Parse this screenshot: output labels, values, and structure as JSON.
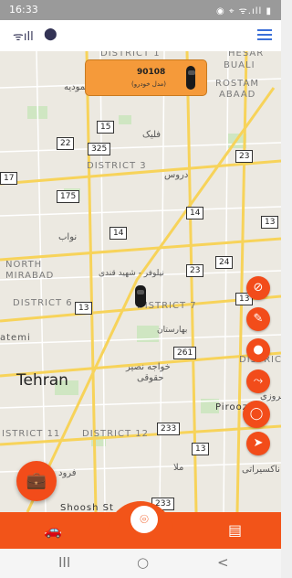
{
  "status_bar": {
    "time": "16:33",
    "right": "◉ ⌖ ᯤ.ıll ▮"
  },
  "header": {
    "signal_icon": "signal-icon",
    "location_icon": "location-pin-icon"
  },
  "map": {
    "districts": [
      "DISTRICT 1",
      "DISTRICT 3",
      "DISTRICT 6",
      "DISTRICT 7",
      "DISTRICT 12",
      "ISTRICT 11",
      "NORTH",
      "MIRABAD",
      "HESAR",
      "BUALI",
      "ROSTAM",
      "ABAAD",
      "DISTRICT"
    ],
    "city": "Tehran",
    "roads": [
      "15",
      "22",
      "325",
      "175",
      "14",
      "14",
      "23",
      "24",
      "23",
      "13",
      "261",
      "233",
      "13",
      "233",
      "17",
      "13",
      "13"
    ],
    "persian": [
      "جمودیه",
      "فلیک",
      "دروس",
      "نواب",
      "نیلوفر - شهید قندی",
      "خواجه نصیر",
      "حقوقی",
      "بهارستان",
      "پیروزی",
      "Piroozi",
      "Shoosh St",
      "فرود",
      "ملا",
      "ناکسیراتی",
      "atemi"
    ]
  },
  "vehicle_card": {
    "plate": "90108",
    "subtitle": "(مدل خودرو)"
  },
  "fab_icons": [
    "no-location-icon",
    "eraser-icon",
    "pin-icon",
    "route-icon",
    "circle-icon",
    "navigate-icon"
  ],
  "briefcase_button_icon": "briefcase-icon",
  "bottom_nav": {
    "left_icon": "car-icon",
    "center_icon": "pin-icon",
    "right_icon": "chat-icon"
  },
  "system_nav": {
    "recent": "III",
    "home": "○",
    "back": "<"
  },
  "colors": {
    "accent": "#f25419",
    "card": "#f59a3a"
  }
}
